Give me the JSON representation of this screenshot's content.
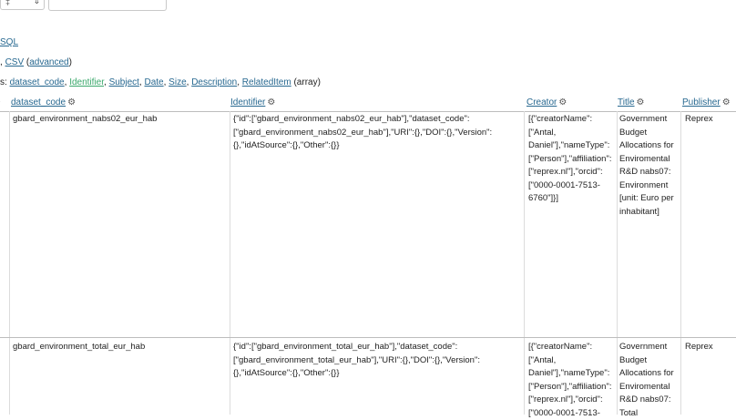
{
  "controls": {
    "select_glyph": "‡",
    "select_arrow": "⇕",
    "input_value": ""
  },
  "links": {
    "sql": "SQL",
    "csv_prefix": ", ",
    "csv": "CSV",
    "advanced_open": " (",
    "advanced": "advanced",
    "advanced_close": ")"
  },
  "columns_line": {
    "prefix": "s: ",
    "items": [
      "dataset_code",
      "Identifier",
      "Subject",
      "Date",
      "Size",
      "Description",
      "RelatedItem"
    ],
    "suffix": " (array)"
  },
  "table": {
    "dot": "•",
    "headers": [
      "dataset_code",
      "Identifier",
      "Creator",
      "Title",
      "Publisher"
    ],
    "rows": [
      {
        "dataset_code": "gbard_environment_nabs02_eur_hab",
        "identifier": "{\"id\":[\"gbard_environment_nabs02_eur_hab\"],\"dataset_code\":[\"gbard_environment_nabs02_eur_hab\"],\"URI\":{},\"DOI\":{},\"Version\":{},\"idAtSource\":{},\"Other\":{}}",
        "creator": "[{\"creatorName\":[\"Antal, Daniel\"],\"nameType\":[\"Person\"],\"affiliation\":[\"reprex.nl\"],\"orcid\":[\"0000-0001-7513-6760\"]}]",
        "title": "Government Budget Allocations for Enviromental R&D nabs07: Environment [unit: Euro per inhabitant]",
        "publisher": "Reprex"
      },
      {
        "dataset_code": "gbard_environment_total_eur_hab",
        "identifier": "{\"id\":[\"gbard_environment_total_eur_hab\"],\"dataset_code\":[\"gbard_environment_total_eur_hab\"],\"URI\":{},\"DOI\":{},\"Version\":{},\"idAtSource\":{},\"Other\":{}}",
        "creator": "[{\"creatorName\":[\"Antal, Daniel\"],\"nameType\":[\"Person\"],\"affiliation\":[\"reprex.nl\"],\"orcid\":[\"0000-0001-7513-",
        "title": "Government Budget Allocations for Enviromental R&D nabs07: Total",
        "publisher": "Reprex"
      }
    ]
  },
  "colors": {
    "link": "#276890",
    "link_visited": "#3aa86b",
    "text": "#222222",
    "border": "#bdbdbd"
  },
  "icons": {
    "column_settings": "gear-icon"
  }
}
